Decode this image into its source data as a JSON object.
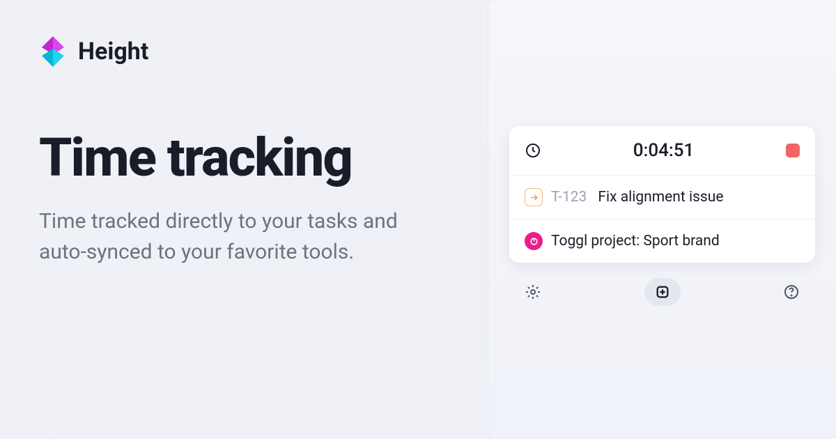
{
  "header": {
    "brand": "Height"
  },
  "hero": {
    "title": "Time tracking",
    "subtitle": "Time tracked directly to your tasks and auto-synced to your favorite tools."
  },
  "widget": {
    "timer": "0:04:51",
    "task": {
      "id": "T-123",
      "title": "Fix alignment issue"
    },
    "project": "Toggl project: Sport brand"
  }
}
